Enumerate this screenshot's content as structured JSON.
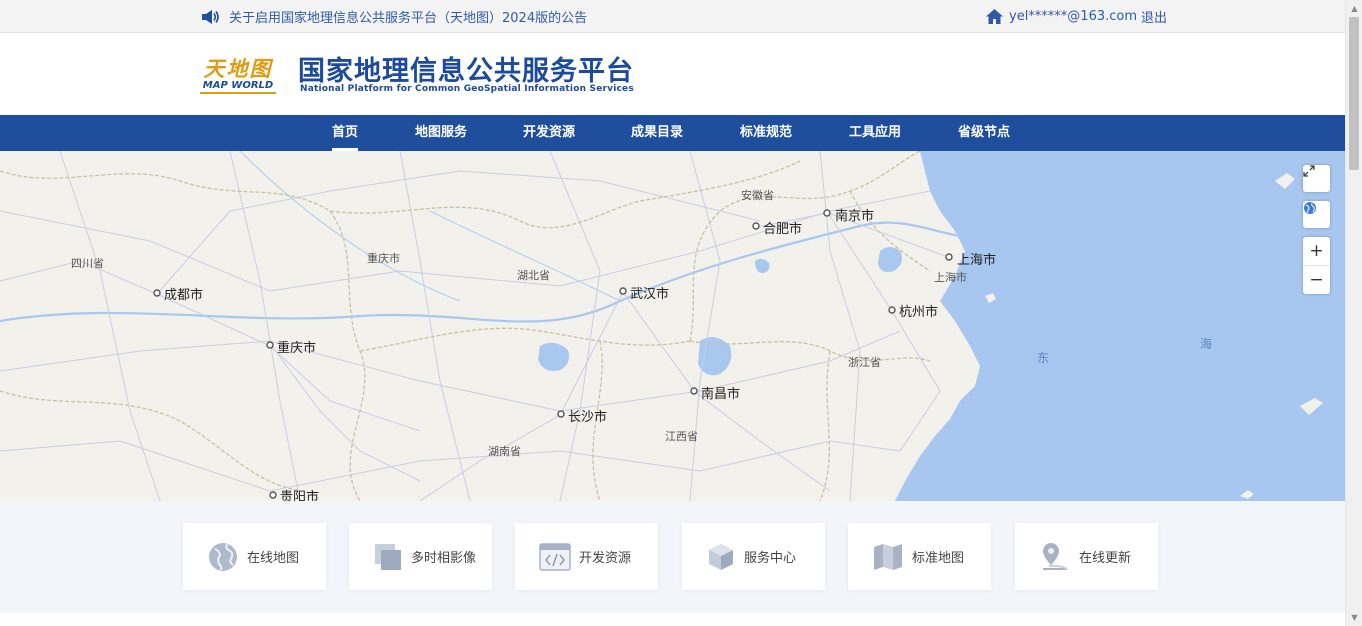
{
  "topbar": {
    "notice": "关于启用国家地理信息公共服务平台（天地图）2024版的公告",
    "user_email": "yel******@163.com",
    "logout": "退出",
    "icons": {
      "notice": "speaker-icon",
      "user": "home-icon"
    }
  },
  "header": {
    "logo_cn": "天地图",
    "logo_en": "MAP WORLD",
    "title": "国家地理信息公共服务平台",
    "subtitle": "National Platform for Common GeoSpatial Information Services"
  },
  "nav": {
    "items": [
      "首页",
      "地图服务",
      "开发资源",
      "成果目录",
      "标准规范",
      "工具应用",
      "省级节点"
    ],
    "active_index": 0
  },
  "map": {
    "labels": {
      "anhui": "安徽省",
      "hefei": "合肥市",
      "nanjing": "南京市",
      "shanghai_city": "上海市",
      "shanghai_prov": "上海市",
      "sichuan": "四川省",
      "chongqing_prov": "重庆市",
      "chengdu": "成都市",
      "hubei": "湖北省",
      "wuhan": "武汉市",
      "hangzhou": "杭州市",
      "chongqing_city": "重庆市",
      "zhejiang": "浙江省",
      "dong": "东",
      "hai": "海",
      "nanchang": "南昌市",
      "changsha": "长沙市",
      "jiangxi": "江西省",
      "hunan": "湖南省",
      "guiyang": "贵阳市"
    },
    "controls": {
      "fullscreen": "fullscreen-icon",
      "globe": "globe-icon",
      "zoom_in": "+",
      "zoom_out": "−"
    },
    "colors": {
      "land": "#f2f1ec",
      "sea": "#a7c7f0",
      "lake": "#a8c8ef",
      "road": "#c9cde6",
      "border": "#c6c3a2"
    }
  },
  "cards": [
    {
      "label": "在线地图",
      "icon": "globe-icon"
    },
    {
      "label": "多时相影像",
      "icon": "layers-icon"
    },
    {
      "label": "开发资源",
      "icon": "code-window-icon"
    },
    {
      "label": "服务中心",
      "icon": "cube-icon"
    },
    {
      "label": "标准地图",
      "icon": "folded-map-icon"
    },
    {
      "label": "在线更新",
      "icon": "location-pin-icon"
    }
  ],
  "colors": {
    "brand": "#1e4e9c",
    "accent": "#e19a14",
    "link": "#2e5aa8"
  }
}
